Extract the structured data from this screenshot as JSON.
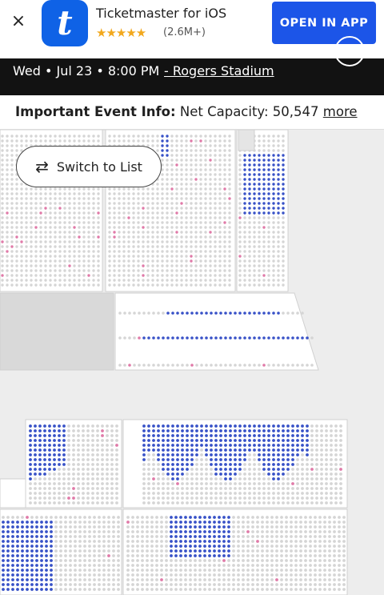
{
  "banner": {
    "app_icon_letter": "t",
    "app_title": "Ticketmaster for iOS",
    "stars": "★★★★★",
    "rating_count": "(2.6M+)",
    "open_label": "OPEN IN APP"
  },
  "event": {
    "date_time": "Wed • Jul 23 • 8:00 PM",
    "venue": "- Rogers Stadium",
    "plus_icon": "plus-circle-icon"
  },
  "info": {
    "label": "Important Event Info:",
    "text": "Net Capacity: 50,547",
    "more_label": "more"
  },
  "seatmap": {
    "switch_label": "Switch to List",
    "switch_icon": "swap-arrows-icon",
    "colors": {
      "available": "#3751c7",
      "resale": "#e07aa8",
      "unavailable": "#d5d5d5",
      "section_bg": "#ffffff",
      "background": "#ededed"
    }
  }
}
